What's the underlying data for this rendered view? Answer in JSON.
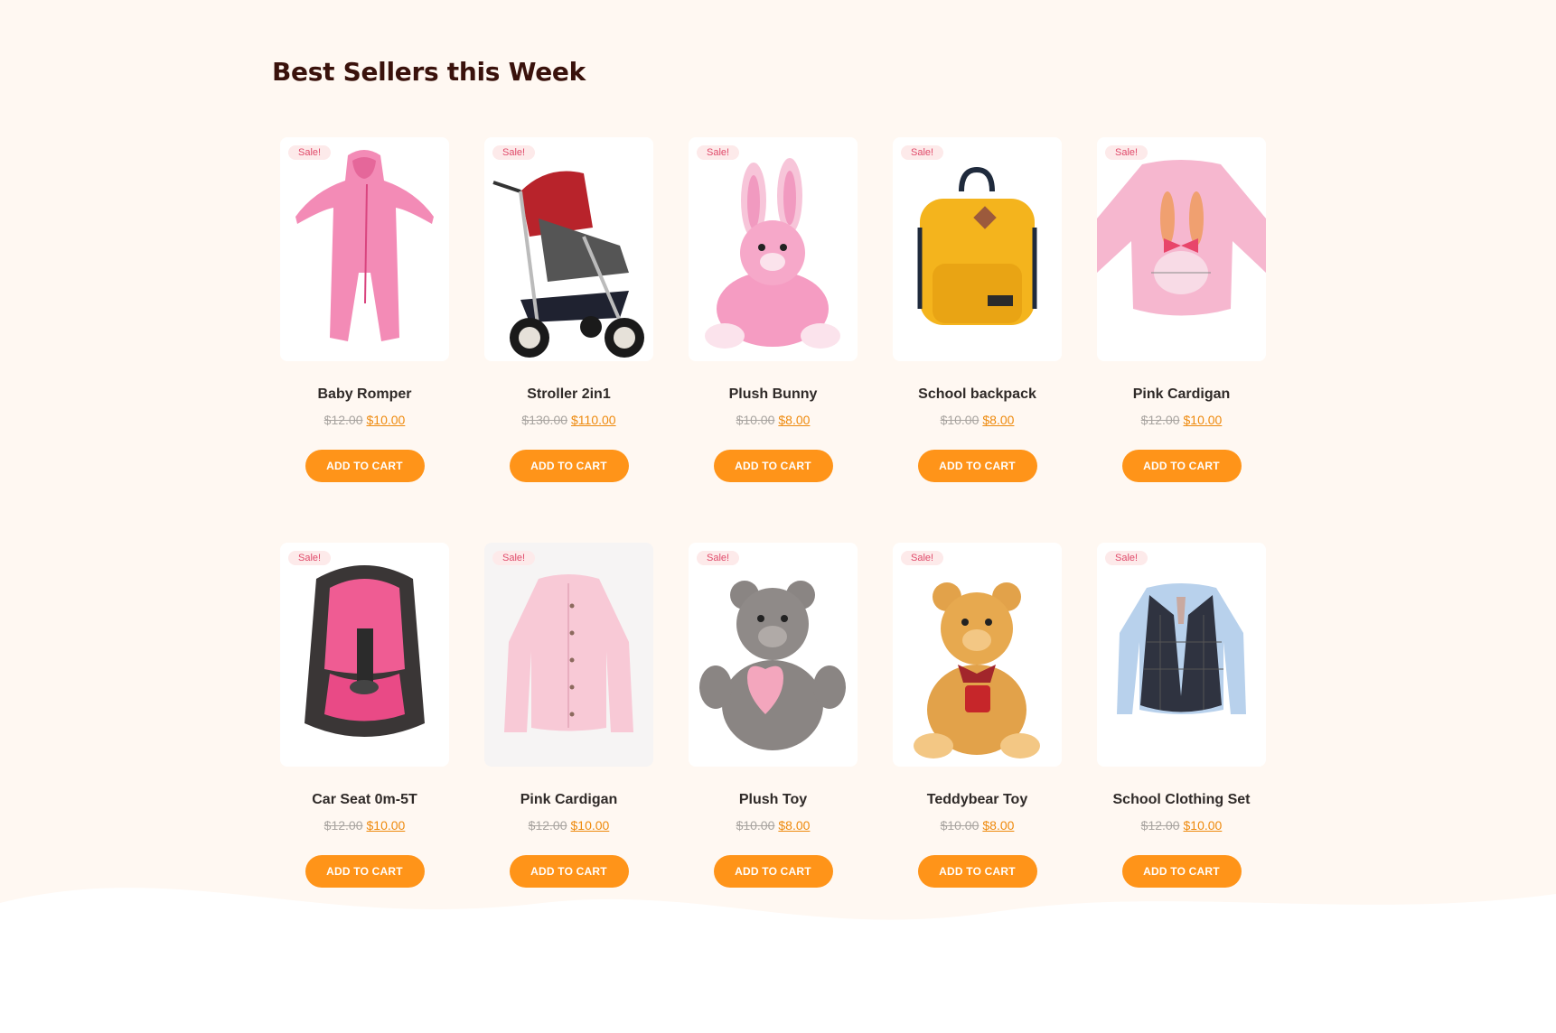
{
  "section": {
    "title": "Best Sellers this Week"
  },
  "sale_label": "Sale!",
  "button_label": "ADD TO CART",
  "products": [
    {
      "name": "Baby Romper",
      "old_price": "$12.00",
      "new_price": "$10.00",
      "icon": "romper-icon"
    },
    {
      "name": "Stroller 2in1",
      "old_price": "$130.00",
      "new_price": "$110.00",
      "icon": "stroller-icon"
    },
    {
      "name": "Plush Bunny",
      "old_price": "$10.00",
      "new_price": "$8.00",
      "icon": "bunny-icon"
    },
    {
      "name": "School backpack",
      "old_price": "$10.00",
      "new_price": "$8.00",
      "icon": "backpack-icon"
    },
    {
      "name": "Pink Cardigan",
      "old_price": "$12.00",
      "new_price": "$10.00",
      "icon": "sweater-icon"
    },
    {
      "name": "Car Seat 0m-5T",
      "old_price": "$12.00",
      "new_price": "$10.00",
      "icon": "car-seat-icon"
    },
    {
      "name": "Pink Cardigan",
      "old_price": "$12.00",
      "new_price": "$10.00",
      "icon": "cardigan-icon"
    },
    {
      "name": "Plush Toy",
      "old_price": "$10.00",
      "new_price": "$8.00",
      "icon": "teddy-heart-icon"
    },
    {
      "name": "Teddybear Toy",
      "old_price": "$10.00",
      "new_price": "$8.00",
      "icon": "teddybear-icon"
    },
    {
      "name": "School Clothing Set",
      "old_price": "$12.00",
      "new_price": "$10.00",
      "icon": "clothing-set-icon"
    }
  ],
  "colors": {
    "background": "#fff8f2",
    "accent": "#ff9419",
    "price_new": "#ee8a0e",
    "sale_text": "#e04a6a",
    "title": "#3a120c"
  }
}
